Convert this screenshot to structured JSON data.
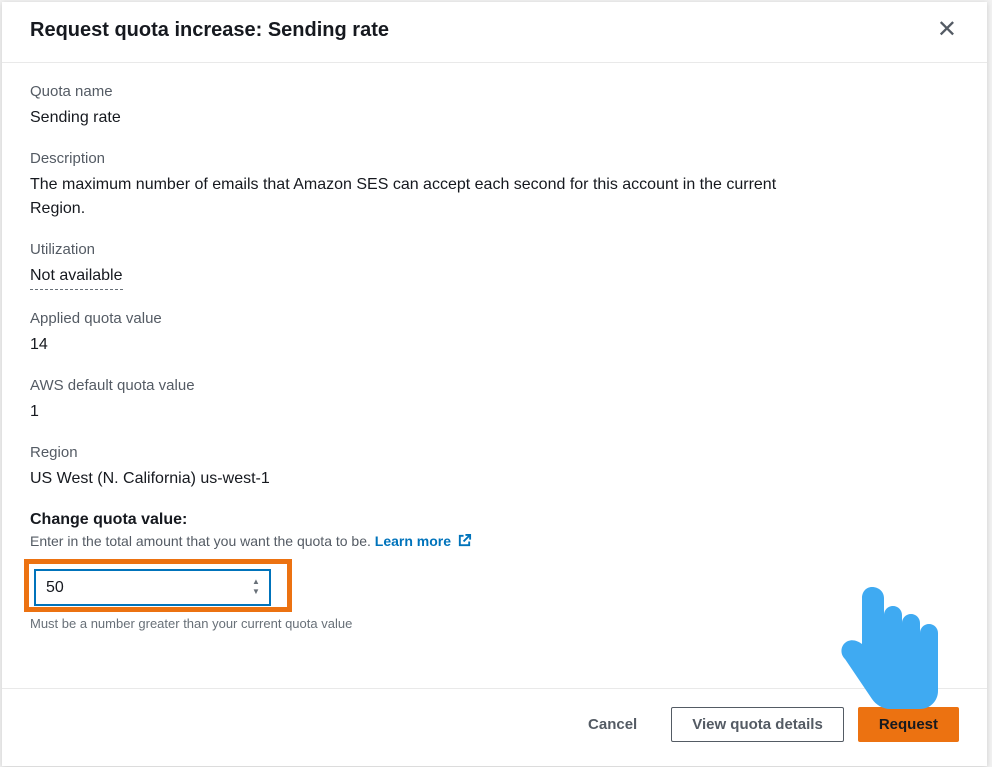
{
  "modal": {
    "title": "Request quota increase: Sending rate",
    "labels": {
      "quota_name": "Quota name",
      "description": "Description",
      "utilization": "Utilization",
      "applied": "Applied quota value",
      "default": "AWS default quota value",
      "region": "Region"
    },
    "values": {
      "quota_name": "Sending rate",
      "description": "The maximum number of emails that Amazon SES can accept each second for this account in the current Region.",
      "utilization": "Not available",
      "applied": "14",
      "default": "1",
      "region": "US West (N. California) us-west-1"
    },
    "change": {
      "label": "Change quota value:",
      "hint": "Enter in the total amount that you want the quota to be.",
      "learn_more": "Learn more",
      "input_value": "50",
      "below_hint": "Must be a number greater than your current quota value"
    },
    "buttons": {
      "cancel": "Cancel",
      "view": "View quota details",
      "request": "Request"
    }
  }
}
